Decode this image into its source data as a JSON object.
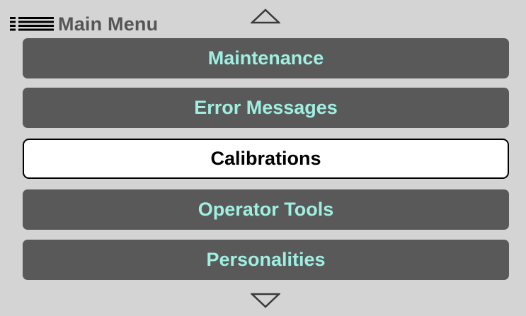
{
  "header": {
    "title": "Main Menu",
    "menu_icon": "list-menu-icon"
  },
  "navigation": {
    "scroll_up_icon": "triangle-up-icon",
    "scroll_down_icon": "triangle-down-icon"
  },
  "menu": {
    "items": [
      {
        "label": "Maintenance",
        "selected": false
      },
      {
        "label": "Error Messages",
        "selected": false
      },
      {
        "label": "Calibrations",
        "selected": true
      },
      {
        "label": "Operator Tools",
        "selected": false
      },
      {
        "label": "Personalities",
        "selected": false
      }
    ]
  },
  "colors": {
    "background": "#d4d4d4",
    "item_background": "#595959",
    "item_text": "#9ff0e2",
    "selected_background": "#ffffff",
    "selected_text": "#000000",
    "title_text": "#555555"
  }
}
